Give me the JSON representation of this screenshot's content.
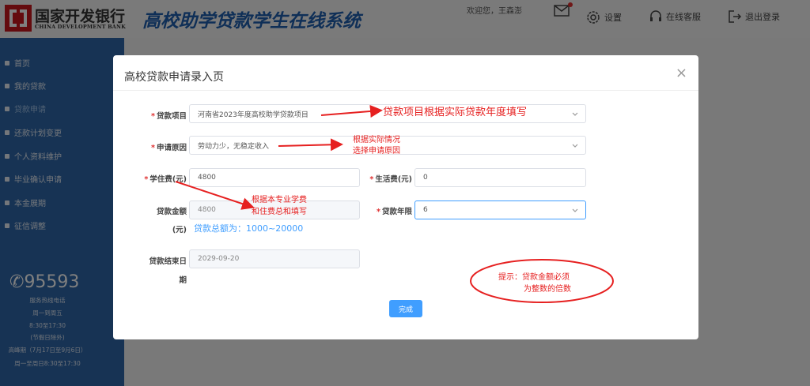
{
  "header": {
    "bank_cn": "国家开发银行",
    "bank_en": "CHINA DEVELOPMENT BANK",
    "system_title": "高校助学贷款学生在线系统",
    "welcome": "欢迎您，王森澎",
    "settings": "设置",
    "service": "在线客服",
    "logout": "退出登录"
  },
  "sidebar": {
    "items": [
      {
        "label": "首页"
      },
      {
        "label": "我的贷款"
      },
      {
        "label": "贷款申请"
      },
      {
        "label": "还款计划变更"
      },
      {
        "label": "个人资料维护"
      },
      {
        "label": "毕业确认申请"
      },
      {
        "label": "本金展期"
      },
      {
        "label": "征信调整"
      }
    ],
    "hotline": "95593",
    "hotline_caption": "服务热线电话",
    "hours_line1": "周一到周五",
    "hours_line2": "8:30至17:30",
    "hours_line3": "(节假日除外)",
    "hours_line4": "高峰期（7月17日至9月6日）",
    "hours_line5": "周一至周日8:30至17:30"
  },
  "modal": {
    "title": "高校贷款申请录入页",
    "close": "×",
    "loan_project_label": "贷款项目",
    "loan_project_value": "河南省2023年度高校助学贷款项目",
    "reason_label": "申请原因",
    "reason_value": "劳动力少，无稳定收入",
    "tuition_label": "学住费(元)",
    "tuition_value": "4800",
    "living_label": "生活费(元)",
    "living_value": "0",
    "amount_label_1": "贷款金额",
    "amount_label_2": "(元)",
    "amount_value": "4800",
    "term_label": "贷款年限",
    "term_value": "6",
    "amount_hint": "贷款总额为：1000~20000",
    "end_label_1": "贷款结束日",
    "end_label_2": "期",
    "end_value": "2029-09-20",
    "submit": "完成"
  },
  "annotations": {
    "project": "贷款项目根据实际贷款年度填写",
    "reason_1": "根据实际情况",
    "reason_2": "选择申请原因",
    "tuition_1": "根据本专业学费",
    "tuition_2": "和住费总和填写",
    "tip_1": "提示：贷款金额必须",
    "tip_2": "为整数的倍数"
  },
  "colors": {
    "sidebar": "#2f67a8",
    "primary": "#409eff",
    "annotation": "#e62020"
  }
}
